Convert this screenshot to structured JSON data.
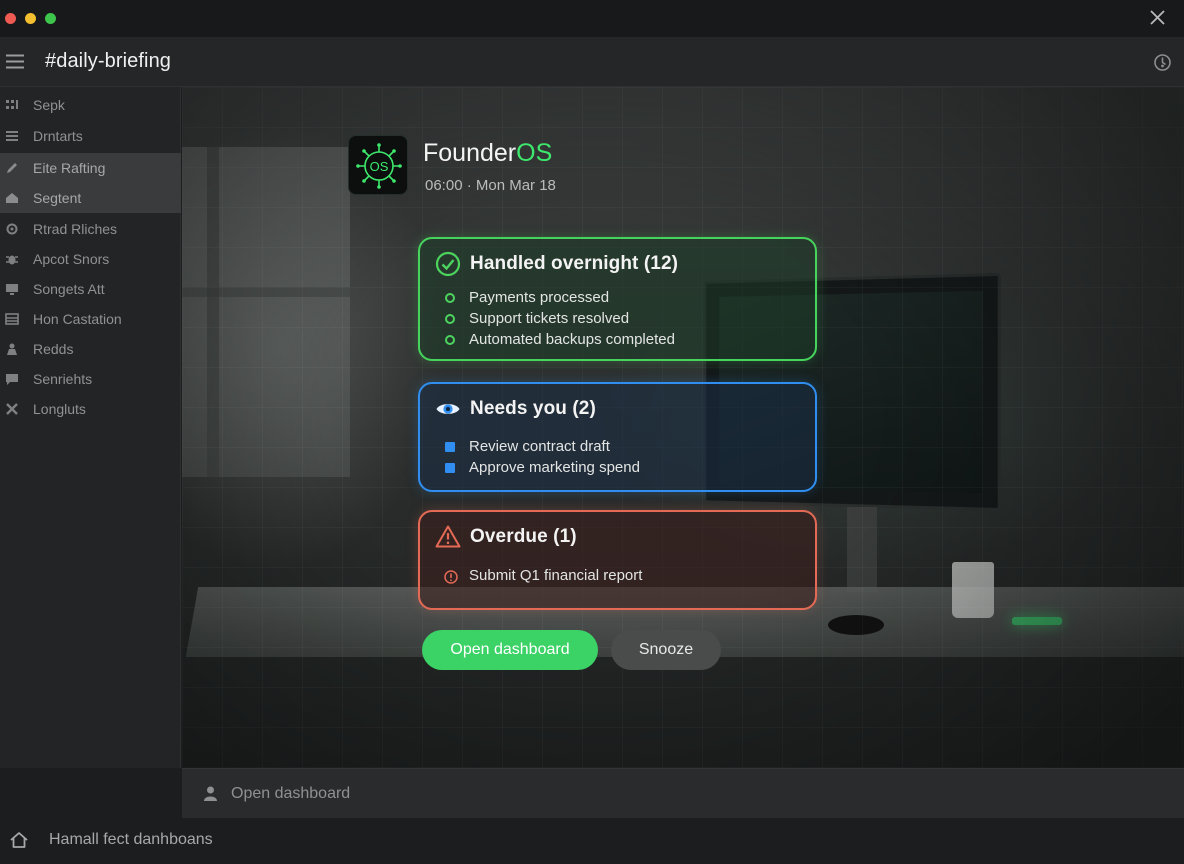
{
  "window": {
    "close_icon": "close-icon"
  },
  "channel": {
    "name": "#daily-briefing",
    "menu_icon": "hamburger-icon",
    "sync_icon": "sync-icon"
  },
  "sidebar": {
    "items": [
      {
        "label": "Sepk",
        "icon": "grid-icon",
        "active": false
      },
      {
        "label": "Drntarts",
        "icon": "list-icon",
        "active": false
      },
      {
        "label": "Eite Rafting",
        "icon": "pencil-icon",
        "active": true
      },
      {
        "label": "Segtent",
        "icon": "home-icon",
        "active": true
      },
      {
        "label": "Rtrad Rliches",
        "icon": "gear-icon",
        "active": false
      },
      {
        "label": "Apcot Snors",
        "icon": "bug-icon",
        "active": false
      },
      {
        "label": "Songets Att",
        "icon": "monitor-icon",
        "active": false
      },
      {
        "label": "Hon Castation",
        "icon": "table-icon",
        "active": false
      },
      {
        "label": "Redds",
        "icon": "person-icon",
        "active": false
      },
      {
        "label": "Senriehts",
        "icon": "chat-icon",
        "active": false
      },
      {
        "label": "Longluts",
        "icon": "tools-icon",
        "active": false
      }
    ]
  },
  "app": {
    "name_main": "Founder",
    "name_accent": "OS",
    "logo_text": "OS",
    "time": "06:00 · Mon Mar 18",
    "accent_color": "#3ee86d"
  },
  "cards": {
    "handled": {
      "title": "Handled overnight (12)",
      "color": "#47d45d",
      "items": [
        "Payments processed",
        "Support tickets resolved",
        "Automated backups completed"
      ]
    },
    "needs": {
      "title": "Needs you (2)",
      "color": "#2f8ef0",
      "items": [
        "Review contract draft",
        "Approve marketing spend"
      ]
    },
    "overdue": {
      "title": "Overdue (1)",
      "color": "#e46a56",
      "items": [
        "Submit Q1 financial report"
      ]
    }
  },
  "actions": {
    "primary": "Open dashboard",
    "secondary": "Snooze"
  },
  "bottom_bar": {
    "text": "Open dashboard",
    "icon": "user-icon"
  },
  "footer": {
    "text": "Hamall fect danhboans",
    "icon": "home-icon"
  }
}
